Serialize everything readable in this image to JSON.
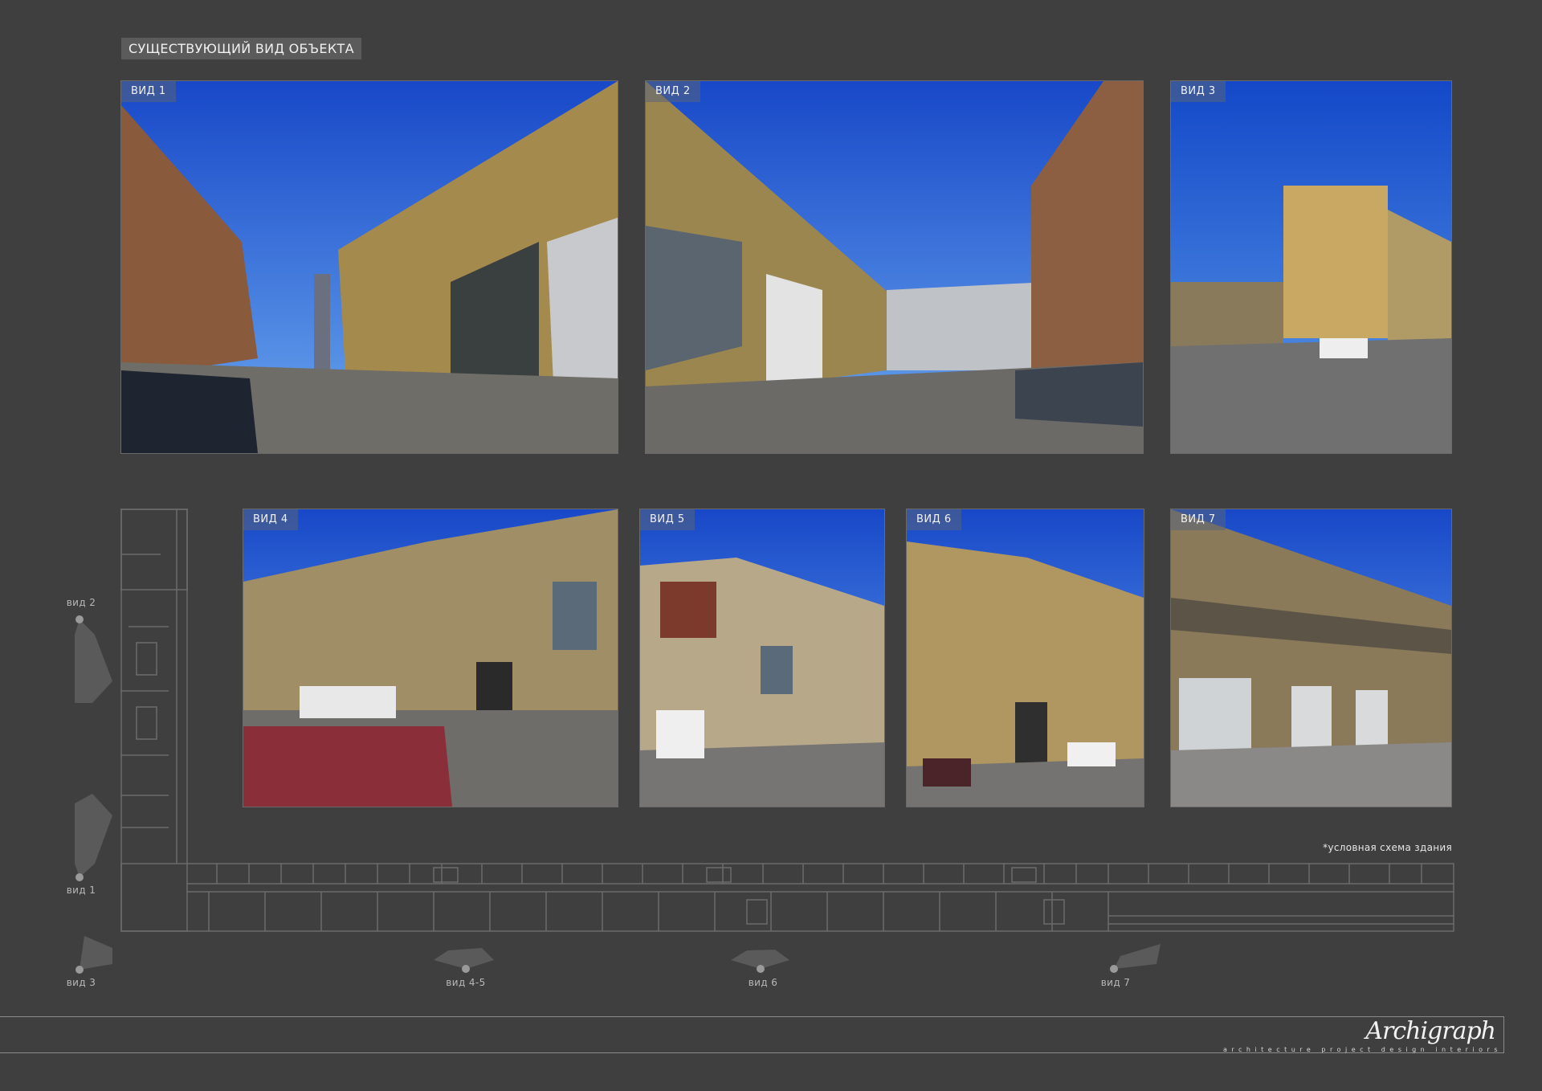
{
  "page_title": "СУЩЕСТВУЮЩИЙ ВИД ОБЪЕКТА",
  "photos": [
    {
      "label": "ВИД 1"
    },
    {
      "label": "ВИД 2"
    },
    {
      "label": "ВИД 3"
    },
    {
      "label": "ВИД 4"
    },
    {
      "label": "ВИД 5"
    },
    {
      "label": "ВИД 6"
    },
    {
      "label": "ВИД 7"
    }
  ],
  "plan_markers": [
    {
      "label": "вид 2"
    },
    {
      "label": "вид 1"
    },
    {
      "label": "вид 3"
    },
    {
      "label": "вид 4-5"
    },
    {
      "label": "вид 6"
    },
    {
      "label": "вид 7"
    }
  ],
  "scheme_note": "*условная схема здания",
  "footer": {
    "logo": "Archigraph",
    "tagline": "architecture project design interiors"
  },
  "colors": {
    "background": "#3f3f3f",
    "title_bg": "#5b5b5b",
    "sky": "#1f5fd6",
    "plan_lines": "#6c6c6c"
  }
}
